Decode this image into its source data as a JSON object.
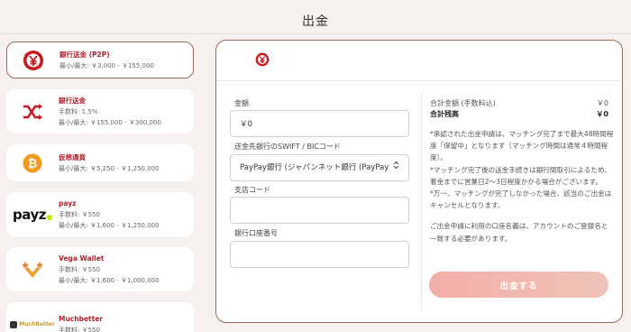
{
  "header": {
    "title": "出金"
  },
  "methods": [
    {
      "name": "銀行送金 (P2P)",
      "limit": "最小/最大: ￥3,000 - ￥155,000",
      "icon": "p2p-bank-icon"
    },
    {
      "name": "銀行送金",
      "fee": "手数料: 1.5%",
      "limit": "最小/最大: ￥155,000 - ￥300,000",
      "icon": "bank-transfer-icon"
    },
    {
      "name": "仮想通貨",
      "limit": "最小/最大: ￥5,250 - ￥1,250,000",
      "icon": "bitcoin-icon"
    },
    {
      "name": "payz",
      "fee": "手数料: ￥550",
      "limit": "最小/最大: ￥1,600 - ￥1,250,000",
      "icon": "payz-logo",
      "logo_text": "payz"
    },
    {
      "name": "Vega Wallet",
      "fee": "手数料: ￥550",
      "limit": "最小/最大: ￥1,600 - ￥1,000,000",
      "icon": "vega-wallet-logo"
    },
    {
      "name": "Muchbetter",
      "fee": "手数料: ￥550",
      "icon": "muchbetter-logo",
      "logo_text": "MuchBetter"
    }
  ],
  "form": {
    "amount_label": "金額",
    "amount_value": "￥0",
    "swift_label": "送金先銀行のSWIFT / BICコード",
    "swift_value": "PayPay銀行 (ジャパンネット銀行 (PayPay",
    "branch_label": "支店コード",
    "branch_value": "",
    "account_label": "銀行口座番号",
    "account_value": ""
  },
  "summary": {
    "total_label": "合計金額 (手数料込)",
    "total_value": "￥0",
    "balance_label": "合計残高",
    "balance_value": "￥0"
  },
  "notes": {
    "line1": "*承認された出金申請は、マッチング完了まで最大48時間程度「保留中」となります（マッチング時間は通常４時間程度）。",
    "line2": "*マッチング完了後の送金手続きは銀行間取引によるため、着金までに営業日2〜3日程度かかる場合がございます。",
    "line3": "*万一、マッチングが完了しなかった場合、該当のご出金はキャンセルとなります。",
    "line4": "ご出金申請に利用の口座名義は、アカウントのご登録名と一致する必要があります。"
  },
  "submit_label": "出金する",
  "colors": {
    "accent": "#b11f2a",
    "border": "#9b6b55",
    "button": "#f2aea7"
  }
}
